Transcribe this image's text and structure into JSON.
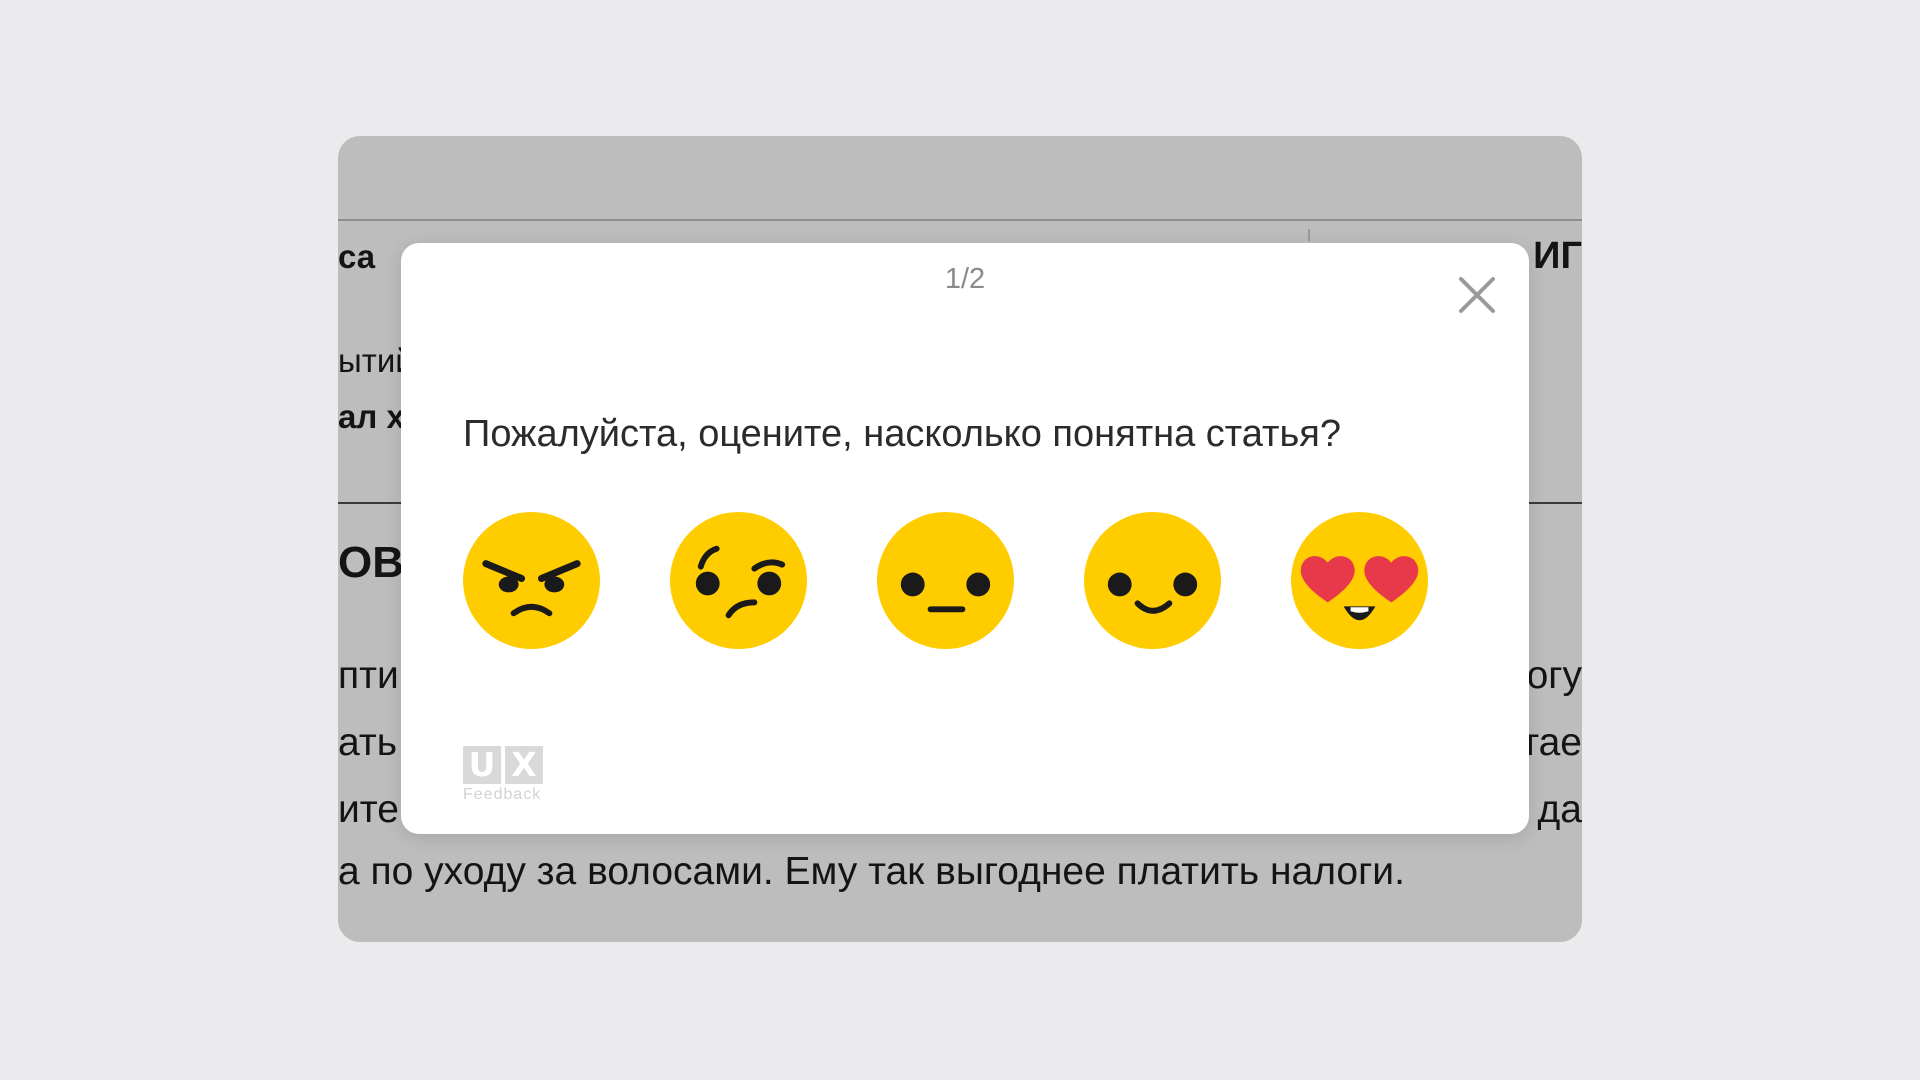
{
  "background": {
    "fragments": [
      {
        "text": "са",
        "style": "bold"
      },
      {
        "text": "ытий",
        "style": "normal"
      },
      {
        "text": "ал х",
        "style": "bold"
      },
      {
        "text": "ОВІ",
        "style": "bold"
      },
      {
        "text": "пти",
        "style": "normal"
      },
      {
        "text": "ать",
        "style": "normal"
      },
      {
        "text": "ите",
        "style": "normal"
      },
      {
        "text": "ИГ",
        "style": "bold"
      },
      {
        "text": "огу",
        "style": "normal"
      },
      {
        "text": "тае",
        "style": "normal"
      },
      {
        "text": "да",
        "style": "normal"
      }
    ],
    "last_line": "а по уходу за волосами. Ему так выгоднее платить налоги."
  },
  "modal": {
    "step": "1/2",
    "question": "Пожалуйста, оцените, насколько понятна статья?",
    "ratings": [
      {
        "label": "angry",
        "icon": "angry-face-icon"
      },
      {
        "label": "confused",
        "icon": "confused-face-icon"
      },
      {
        "label": "neutral",
        "icon": "neutral-face-icon"
      },
      {
        "label": "smile",
        "icon": "smiling-face-icon"
      },
      {
        "label": "love",
        "icon": "heart-eyes-face-icon"
      }
    ],
    "branding": {
      "letters": [
        "U",
        "X"
      ],
      "caption": "Feedback"
    }
  },
  "colors": {
    "page_bg": "#ebebee",
    "overlay_card": "#bdbdbd",
    "emoji_yellow": "#ffcc00",
    "heart_red": "#e8394a",
    "face_feature": "#1a1a1a"
  }
}
